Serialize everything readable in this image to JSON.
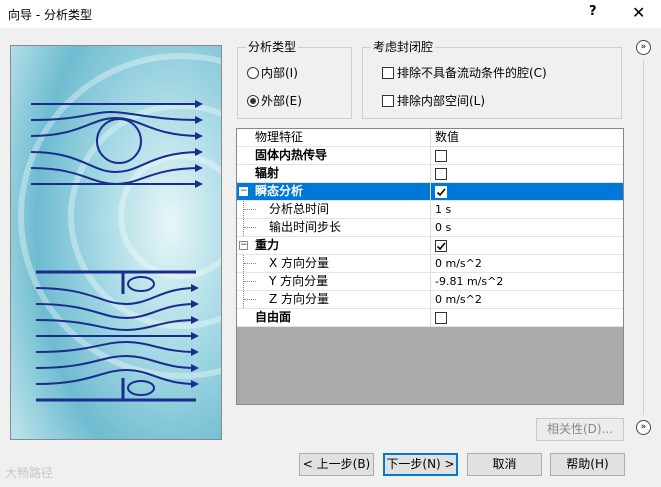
{
  "window": {
    "title": "向导 - 分析类型",
    "help_label": "?",
    "close_label": "✕"
  },
  "analysis_type": {
    "title": "分析类型",
    "options": [
      {
        "label": "内部(I)",
        "selected": false
      },
      {
        "label": "外部(E)",
        "selected": true
      }
    ]
  },
  "closed_cavity": {
    "title": "考虑封闭腔",
    "options": [
      {
        "label": "排除不具备流动条件的腔(C)",
        "checked": false
      },
      {
        "label": "排除内部空间(L)",
        "checked": false
      }
    ]
  },
  "property_grid": {
    "header": {
      "name": "物理特征",
      "value": "数值"
    },
    "rows": [
      {
        "name": "固体内热传导",
        "bold": true,
        "kind": "check",
        "checked": false
      },
      {
        "name": "辐射",
        "bold": true,
        "kind": "check",
        "checked": false
      },
      {
        "name": "瞬态分析",
        "bold": true,
        "kind": "check",
        "checked": true,
        "selected": true,
        "expander": "−"
      },
      {
        "name": "分析总时间",
        "kind": "text",
        "value": "1 s",
        "child": true
      },
      {
        "name": "输出时间步长",
        "kind": "text",
        "value": "0 s",
        "child": true
      },
      {
        "name": "重力",
        "bold": true,
        "kind": "check",
        "checked": true,
        "expander": "−"
      },
      {
        "name": "X 方向分量",
        "kind": "text",
        "value": "0 m/s^2",
        "child": true
      },
      {
        "name": "Y 方向分量",
        "kind": "text",
        "value": "-9.81 m/s^2",
        "child": true
      },
      {
        "name": "Z 方向分量",
        "kind": "text",
        "value": "0 m/s^2",
        "child": true
      },
      {
        "name": "自由面",
        "bold": true,
        "kind": "check",
        "checked": false
      }
    ]
  },
  "buttons": {
    "dependency": "相关性(D)...",
    "back": "< 上一步(B)",
    "next": "下一步(N) >",
    "cancel": "取消",
    "help": "帮助(H)"
  },
  "watermark": "大畅路径",
  "colors": {
    "selection": "#0078d7",
    "grid_background": "#ababab",
    "illustration_lines": "#1a2c8c"
  }
}
